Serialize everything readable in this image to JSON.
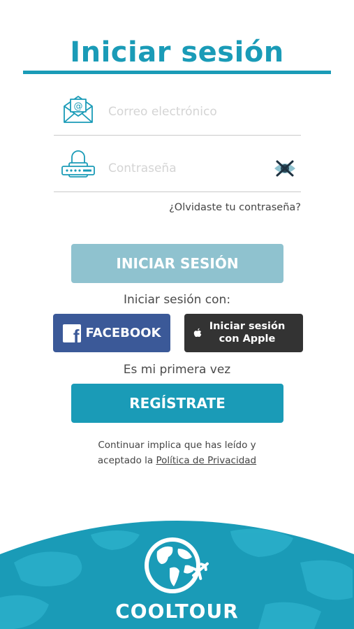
{
  "title": "Iniciar sesión",
  "email": {
    "placeholder": "Correo electrónico",
    "value": ""
  },
  "password": {
    "placeholder": "Contraseña",
    "value": ""
  },
  "forgot_password": "¿Olvidaste tu contraseña?",
  "login_button": "INICIAR SESIÓN",
  "login_with_label": "Iniciar sesión con:",
  "facebook_button": "FACEBOOK",
  "apple_button": {
    "line1": "Iniciar sesión",
    "line2": "con Apple"
  },
  "first_time_label": "Es mi primera vez",
  "register_button": "REGÍSTRATE",
  "legal": {
    "line1": "Continuar implica que has leído y",
    "line2_prefix": "aceptado la",
    "privacy_link": "Política de Privacidad"
  },
  "brand": "COOLTOUR",
  "colors": {
    "accent": "#1a9bb7",
    "login_disabled": "#8fc2cf",
    "facebook": "#3b5998",
    "apple": "#333333"
  },
  "icons": [
    "email-icon",
    "lock-icon",
    "eye-hidden-icon",
    "facebook-icon",
    "apple-icon",
    "globe-icon",
    "airplane-icon"
  ]
}
